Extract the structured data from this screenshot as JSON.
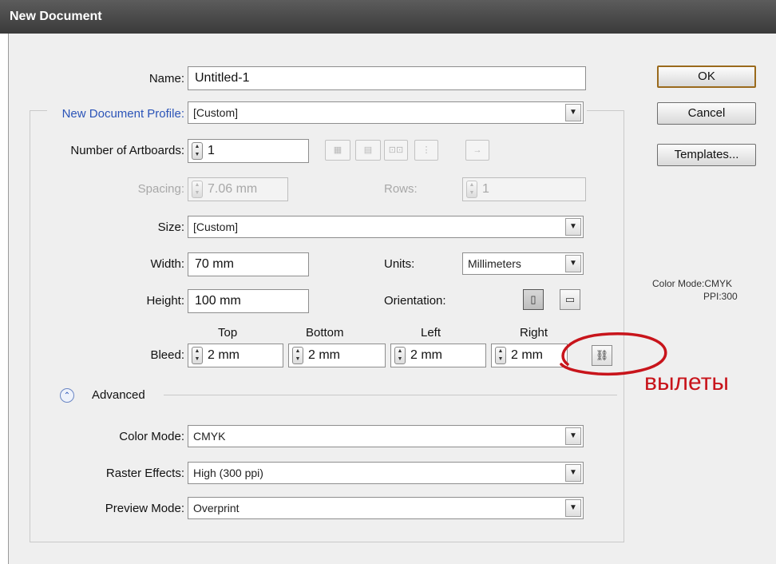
{
  "window": {
    "title": "New Document"
  },
  "fields": {
    "name": {
      "label": "Name:",
      "value": "Untitled-1"
    },
    "profile": {
      "label": "New Document Profile:",
      "value": "[Custom]"
    },
    "artboards": {
      "label": "Number of Artboards:",
      "value": "1"
    },
    "spacing": {
      "label": "Spacing:",
      "value": "7.06 mm"
    },
    "rows": {
      "label": "Rows:",
      "value": "1"
    },
    "size": {
      "label": "Size:",
      "value": "[Custom]"
    },
    "width": {
      "label": "Width:",
      "value": "70 mm"
    },
    "units": {
      "label": "Units:",
      "value": "Millimeters"
    },
    "height": {
      "label": "Height:",
      "value": "100 mm"
    },
    "orientation": {
      "label": "Orientation:",
      "selected": "portrait"
    }
  },
  "bleed": {
    "label": "Bleed:",
    "headers": {
      "top": "Top",
      "bottom": "Bottom",
      "left": "Left",
      "right": "Right"
    },
    "values": {
      "top": "2 mm",
      "bottom": "2 mm",
      "left": "2 mm",
      "right": "2 mm"
    }
  },
  "advanced": {
    "label": "Advanced",
    "color_mode": {
      "label": "Color Mode:",
      "value": "CMYK"
    },
    "raster_effects": {
      "label": "Raster Effects:",
      "value": "High (300 ppi)"
    },
    "preview_mode": {
      "label": "Preview Mode:",
      "value": "Overprint"
    }
  },
  "buttons": {
    "ok": "OK",
    "cancel": "Cancel",
    "templates": "Templates..."
  },
  "info": {
    "color_mode": "Color Mode:CMYK",
    "ppi": "PPI:300"
  },
  "annotation": {
    "text": "вылеты",
    "color": "#c8141b"
  },
  "icons": {
    "arrange": [
      "grid-by-row-icon",
      "grid-by-column-icon",
      "arrange-by-row-icon",
      "arrange-by-column-icon",
      "layout-right-to-left-icon"
    ],
    "orientation": [
      "portrait-icon",
      "landscape-icon"
    ],
    "link": "link-bleed-icon",
    "advanced_toggle": "double-chevron-up-icon"
  }
}
